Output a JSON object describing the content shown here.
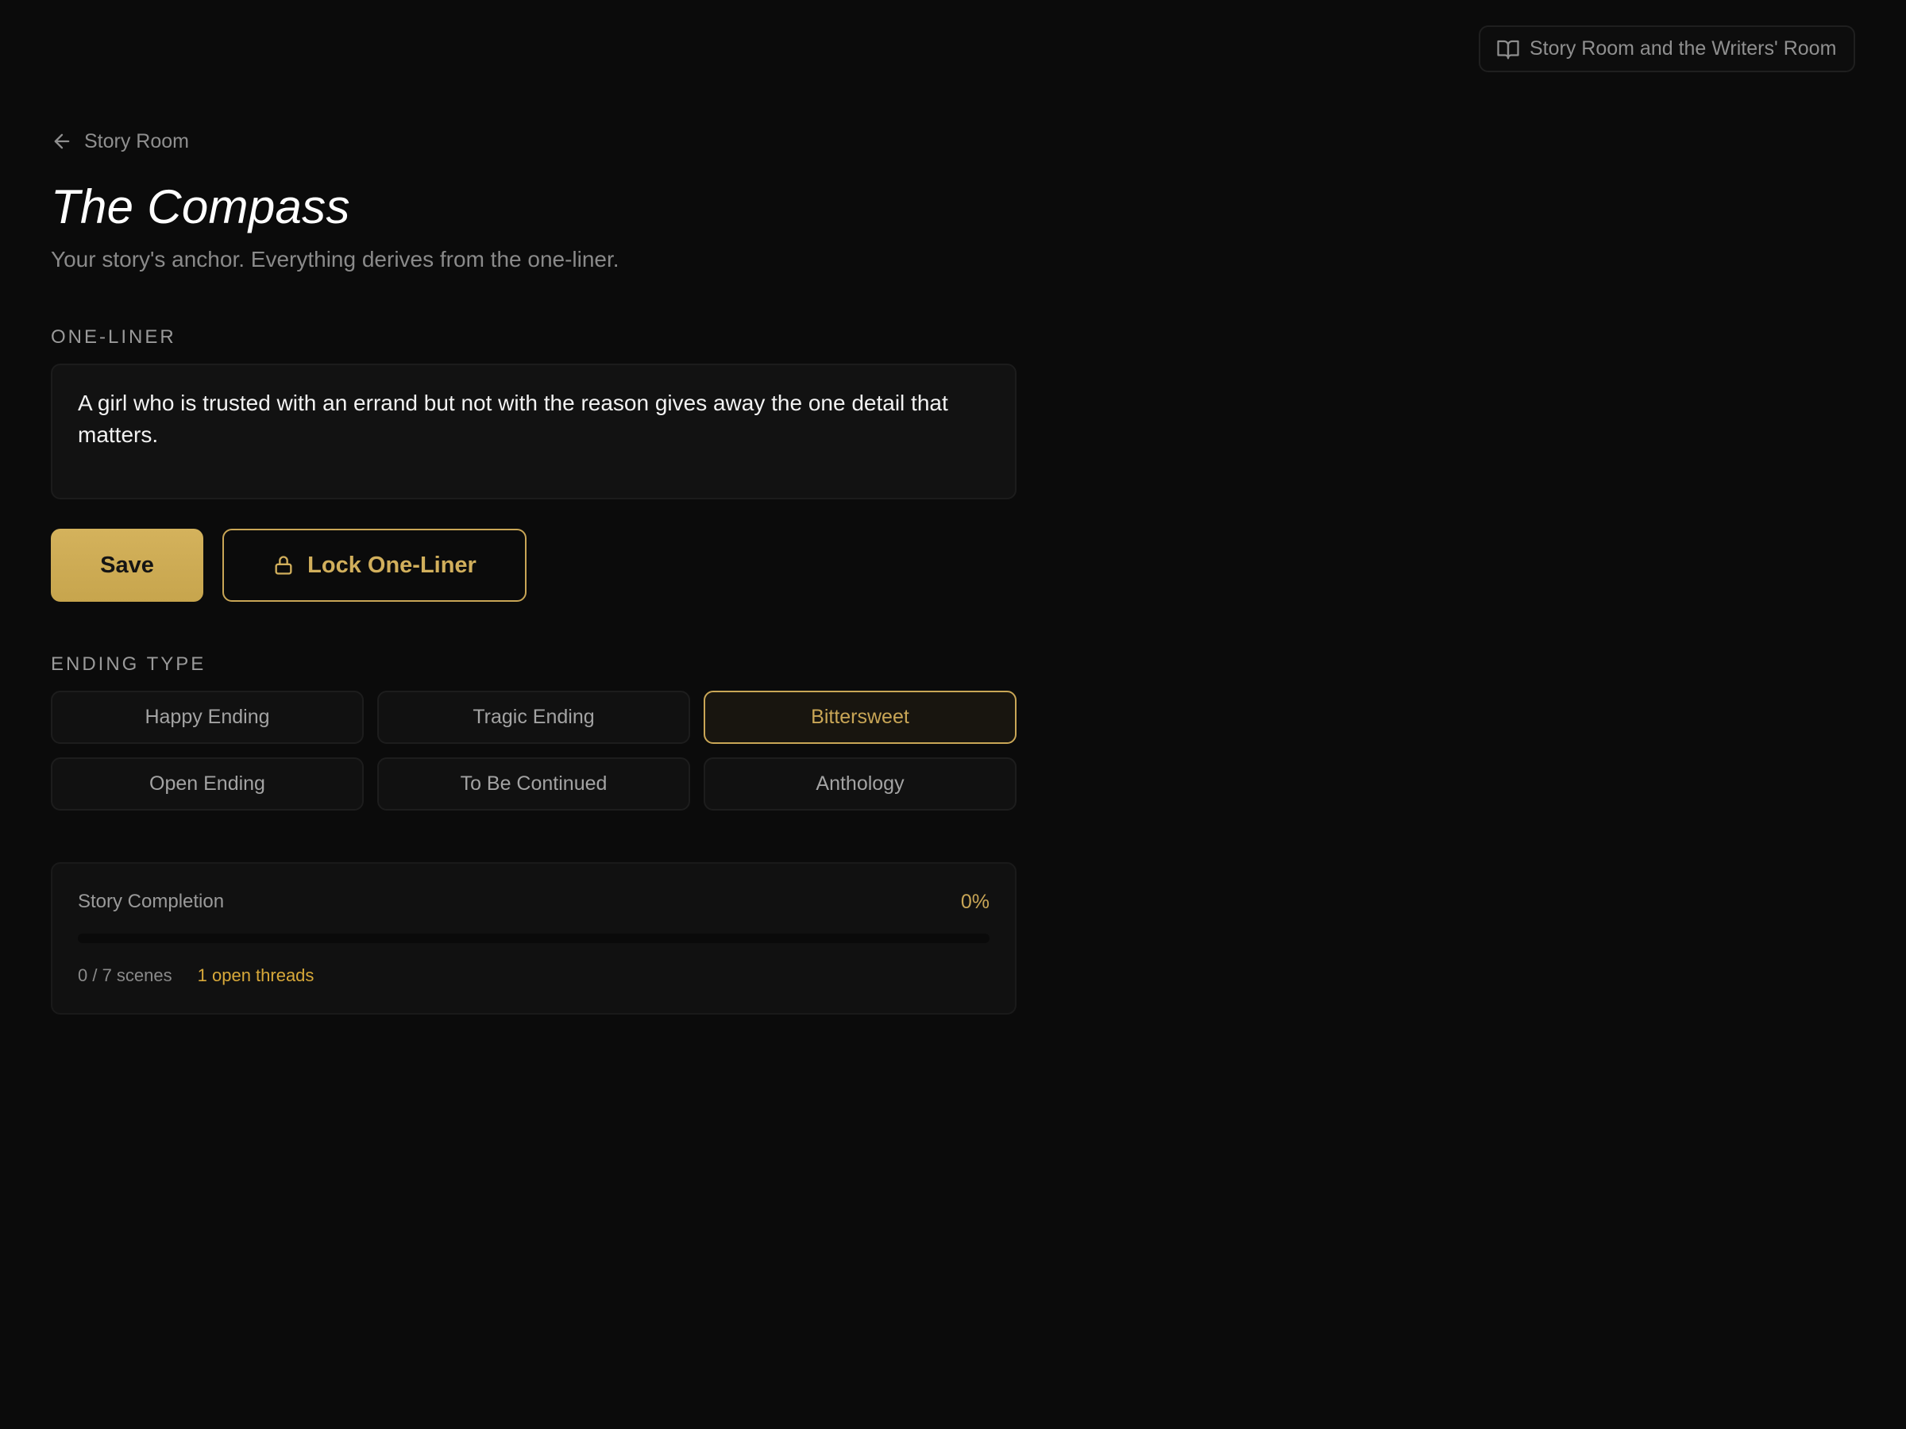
{
  "guide": {
    "label": "Story Room and the Writers' Room",
    "icon": "book-open-icon"
  },
  "nav": {
    "back_label": "Story Room",
    "back_icon": "arrow-left-icon"
  },
  "page": {
    "title": "The Compass",
    "subtitle": "Your story's anchor. Everything derives from the one-liner."
  },
  "oneliner": {
    "label": "ONE-LINER",
    "value": "A girl who is trusted with an errand but not with the reason gives away the one detail that matters."
  },
  "actions": {
    "save_label": "Save",
    "lock_label": "Lock One-Liner",
    "lock_icon": "lock-icon"
  },
  "ending": {
    "label": "ENDING TYPE",
    "selected": "Bittersweet",
    "options": [
      "Happy Ending",
      "Tragic Ending",
      "Bittersweet",
      "Open Ending",
      "To Be Continued",
      "Anthology"
    ]
  },
  "completion": {
    "label": "Story Completion",
    "percent_label": "0%",
    "progress": 0,
    "scenes": "0 / 7 scenes",
    "threads": "1 open threads"
  },
  "colors": {
    "accent": "#c9a656",
    "background": "#0b0b0b",
    "threads": "#d8a93a"
  }
}
